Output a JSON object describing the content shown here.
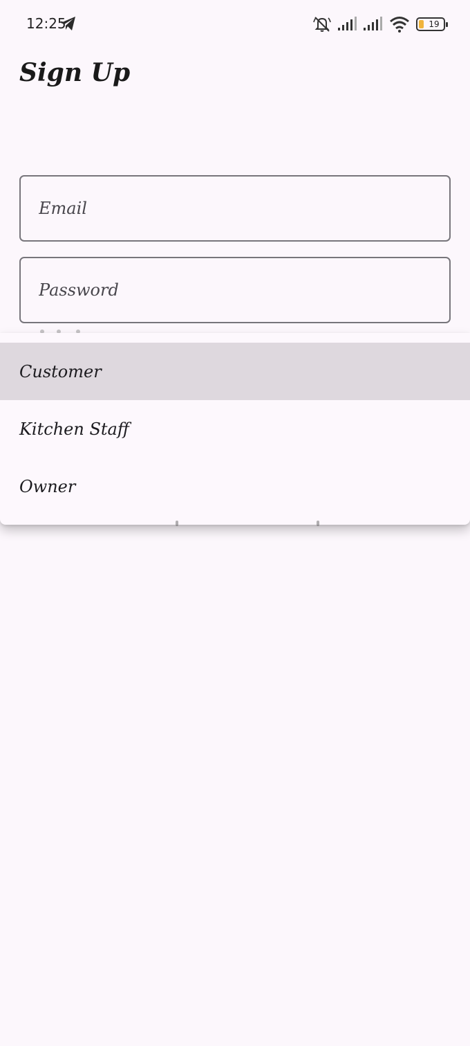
{
  "status_bar": {
    "time": "12:25",
    "battery_level": "19",
    "icons": [
      "telegram-icon",
      "bell-muted-icon",
      "signal-icon",
      "signal-icon",
      "wifi-icon",
      "battery-icon"
    ]
  },
  "page": {
    "title": "Sign Up"
  },
  "form": {
    "email": {
      "placeholder": "Email",
      "value": ""
    },
    "password": {
      "placeholder": "Password",
      "value": ""
    }
  },
  "role_menu": {
    "selected": "Customer",
    "options": [
      "Customer",
      "Kitchen Staff",
      "Owner"
    ]
  },
  "colors": {
    "background": "#fcf7fc",
    "menu_selected": "#ded8de",
    "field_border": "#77757b",
    "battery_fill": "#f0b43c"
  }
}
